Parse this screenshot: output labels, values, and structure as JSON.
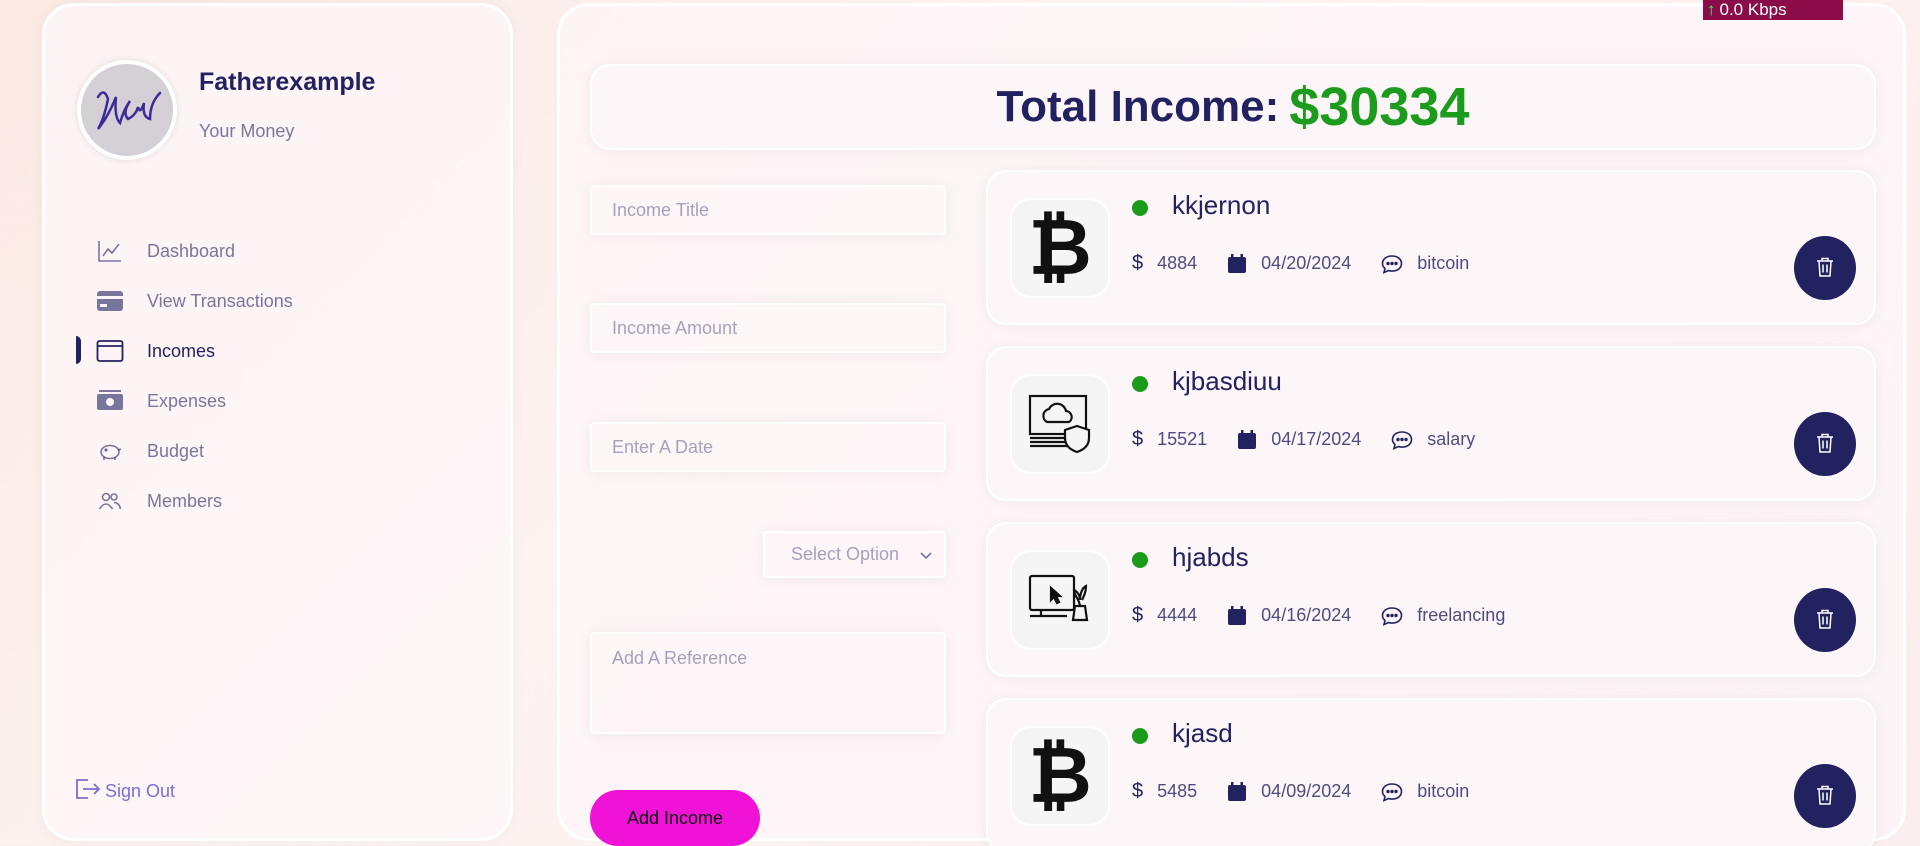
{
  "profile": {
    "name": "Fatherexample",
    "subtitle": "Your Money"
  },
  "nav": [
    {
      "label": "Dashboard",
      "icon": "chart-line-icon",
      "active": false
    },
    {
      "label": "View Transactions",
      "icon": "credit-card-icon",
      "active": false
    },
    {
      "label": "Incomes",
      "icon": "wallet-icon",
      "active": true
    },
    {
      "label": "Expenses",
      "icon": "money-bill-icon",
      "active": false
    },
    {
      "label": "Budget",
      "icon": "piggy-bank-icon",
      "active": false
    },
    {
      "label": "Members",
      "icon": "users-icon",
      "active": false
    }
  ],
  "signout": {
    "label": "Sign Out"
  },
  "network": {
    "label": "0.0 Kbps"
  },
  "total": {
    "label": "Total Income:",
    "value": "$30334"
  },
  "form": {
    "title_placeholder": "Income Title",
    "amount_placeholder": "Income Amount",
    "date_placeholder": "Enter A Date",
    "select_placeholder": "Select Option",
    "reference_placeholder": "Add A Reference",
    "submit_label": "Add Income"
  },
  "incomes": [
    {
      "title": "kkjernon",
      "amount": "4884",
      "date": "04/20/2024",
      "category": "bitcoin",
      "icon": "bitcoin-icon"
    },
    {
      "title": "kjbasdiuu",
      "amount": "15521",
      "date": "04/17/2024",
      "category": "salary",
      "icon": "salary-icon"
    },
    {
      "title": "hjabds",
      "amount": "4444",
      "date": "04/16/2024",
      "category": "freelancing",
      "icon": "freelance-icon"
    },
    {
      "title": "kjasd",
      "amount": "5485",
      "date": "04/09/2024",
      "category": "bitcoin",
      "icon": "bitcoin-icon"
    }
  ],
  "colors": {
    "primary": "#222260",
    "income_green": "#1c9b1c",
    "add_button": "#f012d6",
    "network_badge": "#8a0d4a"
  }
}
